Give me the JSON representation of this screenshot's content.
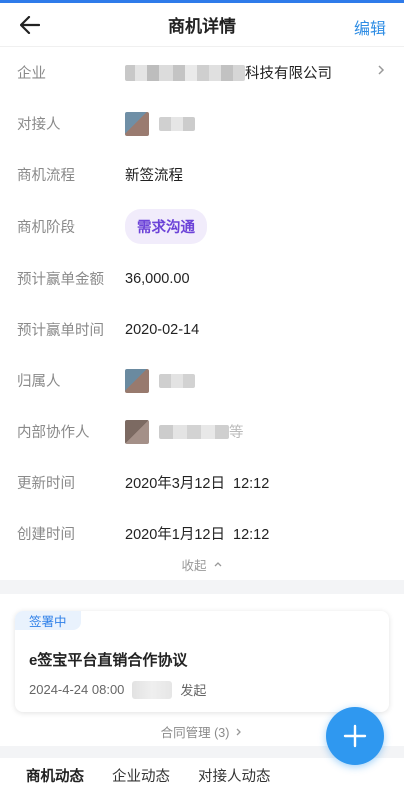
{
  "header": {
    "title": "商机详情",
    "edit_label": "编辑",
    "back_icon": "back-arrow-icon"
  },
  "fields": [
    {
      "label": "企业",
      "value": "科技有限公司",
      "type": "company"
    },
    {
      "label": "对接人",
      "value": "",
      "type": "person"
    },
    {
      "label": "商机流程",
      "value": "新签流程",
      "type": "text"
    },
    {
      "label": "商机阶段",
      "value": "需求沟通",
      "type": "tag"
    },
    {
      "label": "预计赢单金额",
      "value": "36,000.00",
      "type": "text"
    },
    {
      "label": "预计赢单时间",
      "value": "2020-02-14",
      "type": "text"
    },
    {
      "label": "归属人",
      "value": "",
      "type": "person"
    },
    {
      "label": "内部协作人",
      "value": "等",
      "type": "person"
    },
    {
      "label": "更新时间",
      "value": "2020年3月12日  12:12",
      "type": "text"
    },
    {
      "label": "创建时间",
      "value": "2020年1月12日  12:12",
      "type": "text"
    }
  ],
  "collapse_label": "收起",
  "contract": {
    "status": "签署中",
    "title": "e签宝平台直销合作协议",
    "date": "2024-4-24 08:00",
    "action": "发起"
  },
  "contract_manage_label": "合同管理 (3)",
  "tabs": [
    {
      "label": "商机动态",
      "active": true
    },
    {
      "label": "企业动态",
      "active": false
    },
    {
      "label": "对接人动态",
      "active": false
    }
  ],
  "colors": {
    "accent": "#2f8de4",
    "stage_tag_bg": "#f1ecfb",
    "stage_tag_text": "#6c43d8",
    "fab": "#2f98f0"
  }
}
